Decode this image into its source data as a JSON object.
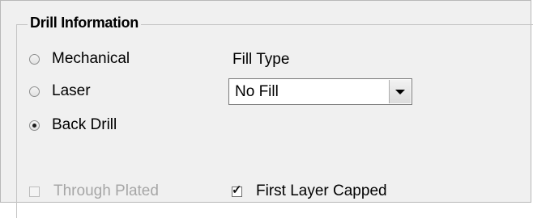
{
  "group": {
    "title": "Drill Information"
  },
  "drill_type": {
    "options": [
      {
        "label": "Mechanical",
        "checked": false
      },
      {
        "label": "Laser",
        "checked": false
      },
      {
        "label": "Back Drill",
        "checked": true
      }
    ]
  },
  "fill_type": {
    "label": "Fill Type",
    "value": "No Fill"
  },
  "options": {
    "through_plated": {
      "label": "Through Plated",
      "checked": false,
      "enabled": false
    },
    "first_layer_capped": {
      "label": "First Layer Capped",
      "checked": true,
      "enabled": true
    }
  }
}
